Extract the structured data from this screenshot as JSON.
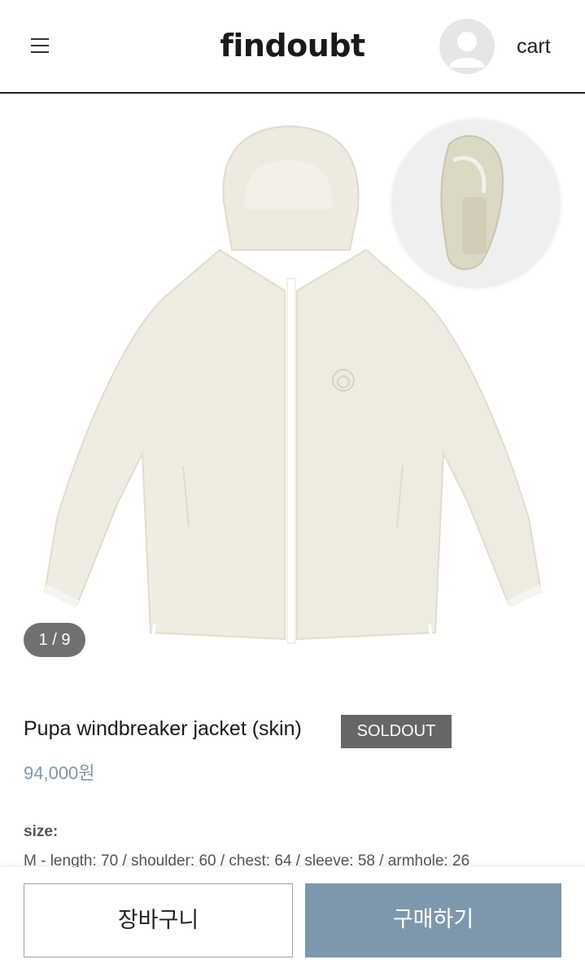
{
  "header": {
    "brand": "findoubt",
    "cart_label": "cart",
    "menu_icon": "hamburger-icon",
    "avatar_icon": "user-avatar-icon"
  },
  "gallery": {
    "counter": "1 / 9",
    "main_image": "beige hooded windbreaker jacket",
    "inset_image": "packed windbreaker pouch"
  },
  "product": {
    "title": "Pupa windbreaker jacket (skin)",
    "status_badge": "SOLDOUT",
    "price": "94,000원",
    "size_label": "size:",
    "size_detail": "M - length: 70 / shoulder: 60 / chest: 64 / sleeve: 58 / armhole: 26"
  },
  "actions": {
    "add_to_cart": "장바구니",
    "buy_now": "구매하기"
  },
  "colors": {
    "accent": "#7d98ad",
    "price": "#7f97aa",
    "badge_bg": "#666666"
  }
}
